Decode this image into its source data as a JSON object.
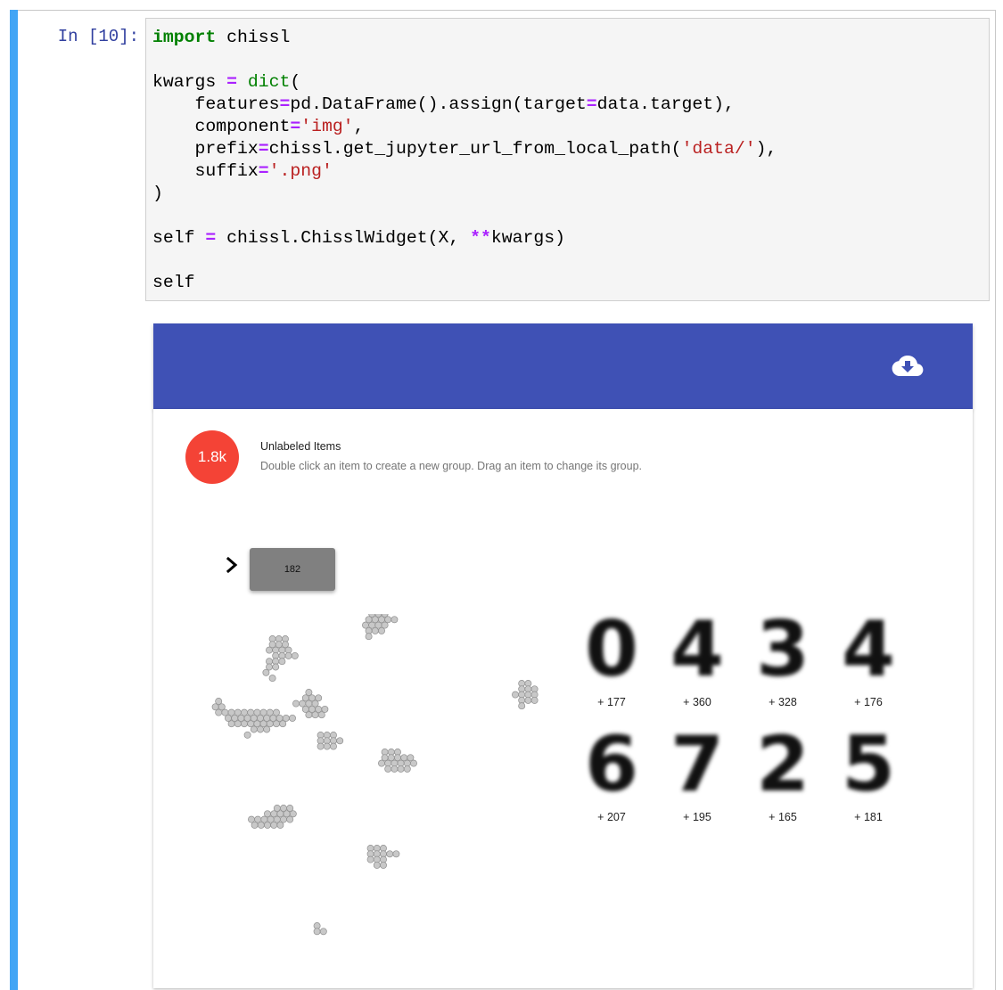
{
  "cell": {
    "prompt": "In [10]:",
    "colors": {
      "active_bar": "#42a5f5",
      "prompt": "#303f9f"
    }
  },
  "widget": {
    "colors": {
      "appbar": "#3f51b5",
      "avatar": "#f44336",
      "chip": "#808080",
      "cluster": "#c8c8c8"
    },
    "appbar": {
      "icon": "cloud-download-icon"
    },
    "header": {
      "count": "1.8k",
      "title": "Unlabeled Items",
      "subtitle": "Double click an item to create a new group. Drag an item to change its group."
    },
    "group": {
      "label": "182",
      "expand_icon": "chevron-right-icon"
    },
    "digits": [
      {
        "digit": "0",
        "count": "+ 177"
      },
      {
        "digit": "4",
        "count": "+ 360"
      },
      {
        "digit": "3",
        "count": "+ 328"
      },
      {
        "digit": "4",
        "count": "+ 176"
      },
      {
        "digit": "6",
        "count": "+ 207"
      },
      {
        "digit": "7",
        "count": "+ 195"
      },
      {
        "digit": "2",
        "count": "+ 165"
      },
      {
        "digit": "5",
        "count": "+ 181"
      }
    ]
  }
}
